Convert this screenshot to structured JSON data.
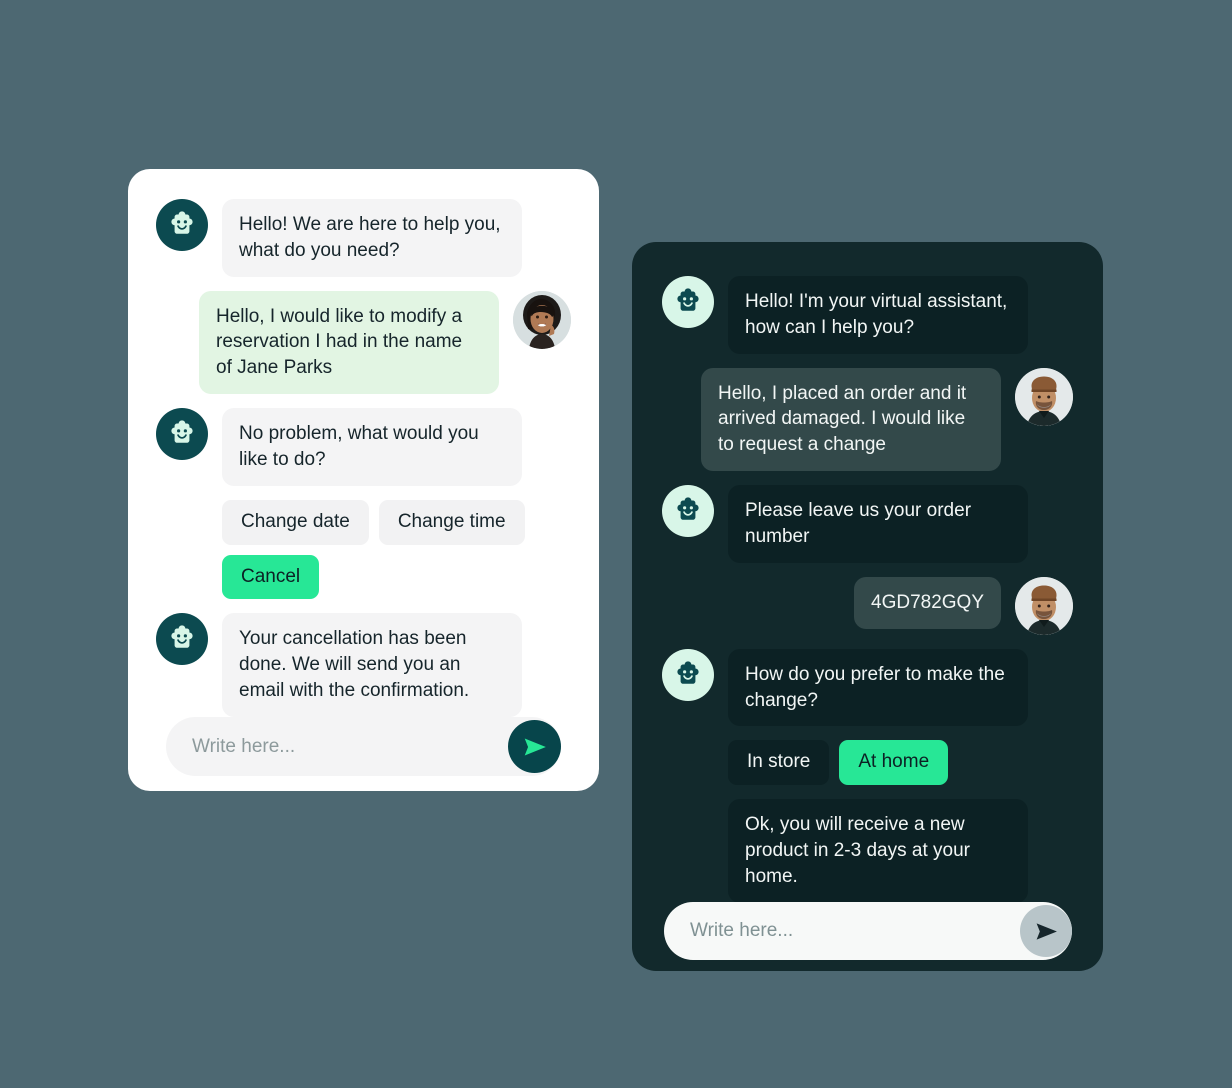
{
  "theme": {
    "page_background": "#4d6872",
    "accent_green": "#27e796",
    "dark_panel_background": "#12292c",
    "light_panel_background": "#ffffff",
    "bot_avatar_dark_teal": "#0c4a50",
    "bot_avatar_mint": "#d8f6e8"
  },
  "light_chat": {
    "messages": [
      {
        "sender": "bot",
        "avatar_icon": "robot-face-icon",
        "text": "Hello! We are here to help you, what do you need?"
      },
      {
        "sender": "user",
        "avatar_icon": "user-avatar-woman",
        "text": "Hello, I would like to modify a reservation I had in the name of Jane Parks"
      },
      {
        "sender": "bot",
        "avatar_icon": "robot-face-icon",
        "text": "No problem, what would you like to do?"
      },
      {
        "sender": "bot",
        "avatar_icon": "robot-face-icon",
        "text": "Your cancellation has been done. We will send you an email with the confirmation."
      }
    ],
    "quick_replies": [
      {
        "label": "Change date",
        "active": false
      },
      {
        "label": "Change time",
        "active": false
      },
      {
        "label": "Cancel",
        "active": true
      }
    ],
    "composer": {
      "placeholder": "Write here...",
      "value": "",
      "send_icon": "send-arrow-icon"
    }
  },
  "dark_chat": {
    "messages": [
      {
        "sender": "bot",
        "avatar_icon": "robot-face-icon",
        "text": "Hello! I'm your virtual assistant, how can I help you?"
      },
      {
        "sender": "user",
        "avatar_icon": "user-avatar-man",
        "text": "Hello, I placed an order and it arrived damaged. I would like to request a change"
      },
      {
        "sender": "bot",
        "avatar_icon": "robot-face-icon",
        "text": "Please leave us your order number"
      },
      {
        "sender": "user",
        "avatar_icon": "user-avatar-man",
        "text": "4GD782GQY"
      },
      {
        "sender": "bot",
        "avatar_icon": "robot-face-icon",
        "text": "How do you prefer to make the change?"
      },
      {
        "sender": "bot",
        "avatar_icon": "robot-face-icon",
        "text": "Ok, you will receive a new product in 2-3 days at your home."
      }
    ],
    "quick_replies": [
      {
        "label": "In store",
        "active": false
      },
      {
        "label": "At home",
        "active": true
      }
    ],
    "composer": {
      "placeholder": "Write here...",
      "value": "",
      "send_icon": "send-arrow-icon"
    }
  }
}
